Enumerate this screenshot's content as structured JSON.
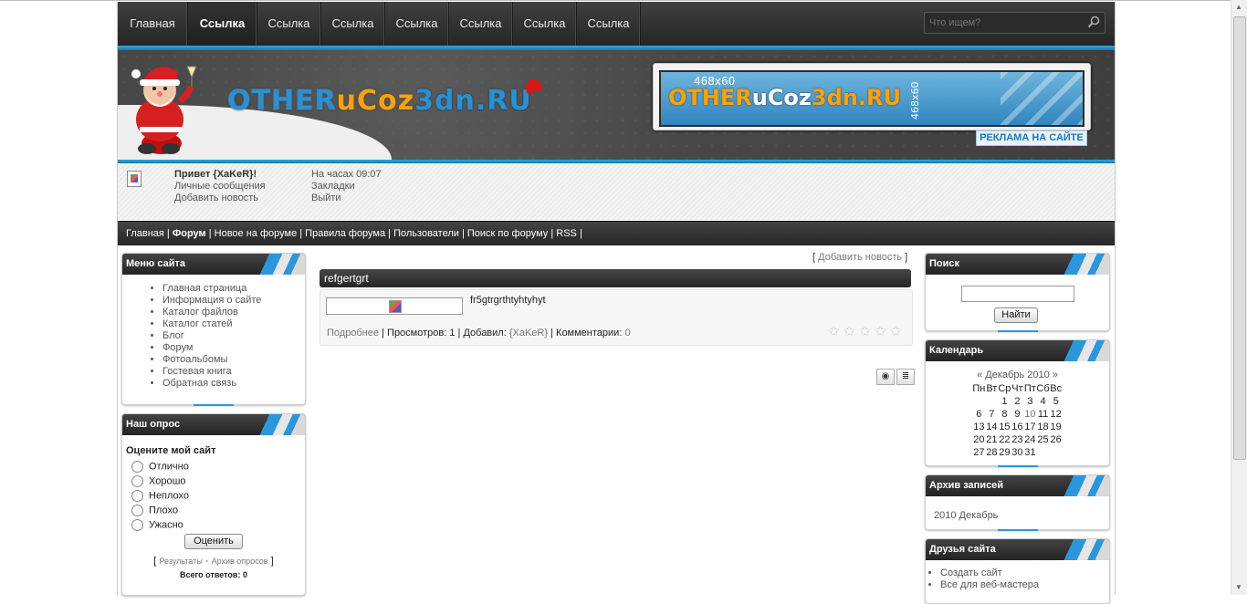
{
  "topnav": {
    "items": [
      "Главная",
      "Ссылка",
      "Ссылка",
      "Ссылка",
      "Ссылка",
      "Ссылка",
      "Ссылка",
      "Ссылка"
    ],
    "search_placeholder": "Что ищем?"
  },
  "header": {
    "logo_parts": [
      "OTHER",
      "uCoz",
      "3dn.RU"
    ],
    "banner_size": "468x60",
    "banner_logo_parts": [
      "OTHER",
      "uCoz",
      "3dn.RU"
    ],
    "ad_label": "РЕКЛАМА НА САЙТЕ"
  },
  "userpanel": {
    "greeting": "Привет {XaKeR}!",
    "private_messages": "Личные сообщения",
    "add_news": "Добавить новость",
    "time": "На часах 09:07",
    "bookmarks": "Закладки",
    "logout": "Выйти"
  },
  "forumbar": {
    "items": [
      "Главная",
      "Форум",
      "Новое на форуме",
      "Правила форума",
      "Пользователи",
      "Поиск по форуму",
      "RSS"
    ]
  },
  "menu": {
    "title": "Меню сайта",
    "items": [
      "Главная страница",
      "Информация о сайте",
      "Каталог файлов",
      "Каталог статей",
      "Блог",
      "Форум",
      "Фотоальбомы",
      "Гостевая книга",
      "Обратная связь"
    ]
  },
  "poll": {
    "title": "Наш опрос",
    "question": "Оцените мой сайт",
    "options": [
      "Отлично",
      "Хорошо",
      "Неплохо",
      "Плохо",
      "Ужасно"
    ],
    "vote_label": "Оценить",
    "results": "Результаты",
    "archive": "Архив опросов",
    "total_label": "Всего ответов:",
    "total": "0"
  },
  "content": {
    "add_news_link": "Добавить новость",
    "entry_title": "refgertgrt",
    "entry_text": "fr5gtrgrthtyhtyhyt",
    "more": "Подробнее",
    "views_label": "Просмотров: 1",
    "added_label": "Добавил:",
    "author": "{XaKeR}",
    "comments_label": "Комментарии:",
    "comments": "0",
    "rating": 0
  },
  "search": {
    "title": "Поиск",
    "button": "Найти",
    "value": ""
  },
  "calendar": {
    "title": "Календарь",
    "prev": "«",
    "next": "»",
    "month": "Декабрь 2010",
    "weekdays": [
      "Пн",
      "Вт",
      "Ср",
      "Чт",
      "Пт",
      "Сб",
      "Вс"
    ],
    "weeks": [
      [
        "",
        "",
        "1",
        "2",
        "3",
        "4",
        "5"
      ],
      [
        "6",
        "7",
        "8",
        "9",
        "10",
        "11",
        "12"
      ],
      [
        "13",
        "14",
        "15",
        "16",
        "17",
        "18",
        "19"
      ],
      [
        "20",
        "21",
        "22",
        "23",
        "24",
        "25",
        "26"
      ],
      [
        "27",
        "28",
        "29",
        "30",
        "31",
        "",
        ""
      ]
    ],
    "today": "10"
  },
  "archive": {
    "title": "Архив записей",
    "items": [
      "2010 Декабрь"
    ]
  },
  "friends": {
    "title": "Друзья сайта",
    "items": [
      "Создать сайт",
      "Все для веб-мастера"
    ]
  },
  "colors": {
    "accent": "#2d96da",
    "dark": "#2a2a2a"
  }
}
